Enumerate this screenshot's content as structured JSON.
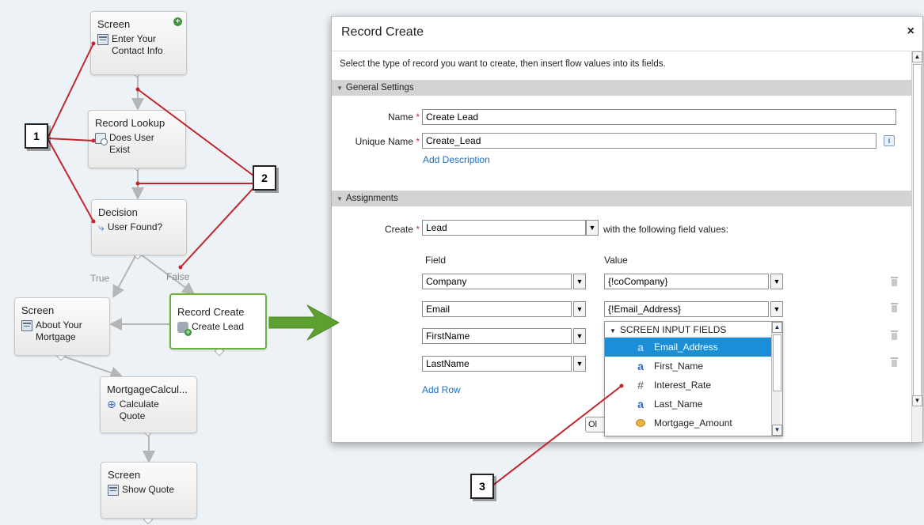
{
  "flow": {
    "nodes": {
      "screen1": {
        "type": "Screen",
        "label": "Enter Your Contact Info"
      },
      "lookup": {
        "type": "Record Lookup",
        "label": "Does User Exist"
      },
      "decision": {
        "type": "Decision",
        "label": "User Found?"
      },
      "screen2": {
        "type": "Screen",
        "label": "About Your Mortgage"
      },
      "create": {
        "type": "Record Create",
        "label": "Create Lead"
      },
      "apex": {
        "type": "MortgageCalcul...",
        "label": "Calculate Quote"
      },
      "screen3": {
        "type": "Screen",
        "label": "Show Quote"
      }
    },
    "connector_true": "True",
    "connector_false": "False"
  },
  "callouts": [
    "1",
    "2",
    "3"
  ],
  "dialog": {
    "title": "Record Create",
    "close": "×",
    "description": "Select the type of record you want to create, then insert flow values into its fields.",
    "general_settings": {
      "heading": "General Settings",
      "name_label": "Name",
      "name_value": "Create Lead",
      "unique_name_label": "Unique Name",
      "unique_name_value": "Create_Lead",
      "info": "i",
      "add_description": "Add Description"
    },
    "assignments": {
      "heading": "Assignments",
      "create_label": "Create",
      "create_value": "Lead",
      "create_suffix": "with the following field values:",
      "field_header": "Field",
      "value_header": "Value",
      "rows": [
        {
          "field": "Company",
          "value": "{!coCompany}"
        },
        {
          "field": "Email",
          "value": "{!Email_Address}"
        },
        {
          "field": "FirstName",
          "value": ""
        },
        {
          "field": "LastName",
          "value": ""
        }
      ],
      "add_row": "Add Row",
      "ok_partial": "Ol"
    },
    "value_dropdown": {
      "header": "SCREEN INPUT FIELDS",
      "items": [
        {
          "icon": "text-field-icon",
          "glyph": "a",
          "label": "Email_Address",
          "selected": true
        },
        {
          "icon": "text-field-icon",
          "glyph": "a",
          "label": "First_Name",
          "selected": false
        },
        {
          "icon": "number-field-icon",
          "glyph": "#",
          "label": "Interest_Rate",
          "selected": false
        },
        {
          "icon": "text-field-icon",
          "glyph": "a",
          "label": "Last_Name",
          "selected": false
        },
        {
          "icon": "currency-field-icon",
          "glyph": "",
          "label": "Mortgage_Amount",
          "selected": false
        }
      ]
    }
  },
  "colors": {
    "selected_node_border": "#6ab23d",
    "annotation_line": "#c0282e",
    "arrow": "#5ea02f",
    "dropdown_highlight": "#1a8fd8",
    "link": "#1f6fbf",
    "required": "#c23934"
  }
}
